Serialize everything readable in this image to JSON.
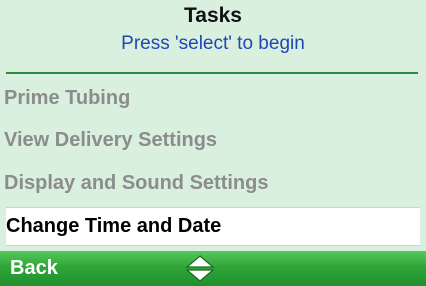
{
  "header": {
    "title": "Tasks",
    "subtitle": "Press 'select' to begin"
  },
  "menu": {
    "items": [
      {
        "label": "Prime Tubing",
        "selected": false
      },
      {
        "label": "View Delivery Settings",
        "selected": false
      },
      {
        "label": "Display and Sound Settings",
        "selected": false
      },
      {
        "label": "Change Time and Date",
        "selected": true
      }
    ]
  },
  "softkeys": {
    "left_label": "Back",
    "center_icon": "up-down-arrows-icon"
  },
  "colors": {
    "screen_background": "#d9f0df",
    "subtitle_text": "#1f47b8",
    "unselected_text": "#8c8c8c",
    "selected_background": "#ffffff",
    "softkey_bar": "#2fa63a"
  }
}
